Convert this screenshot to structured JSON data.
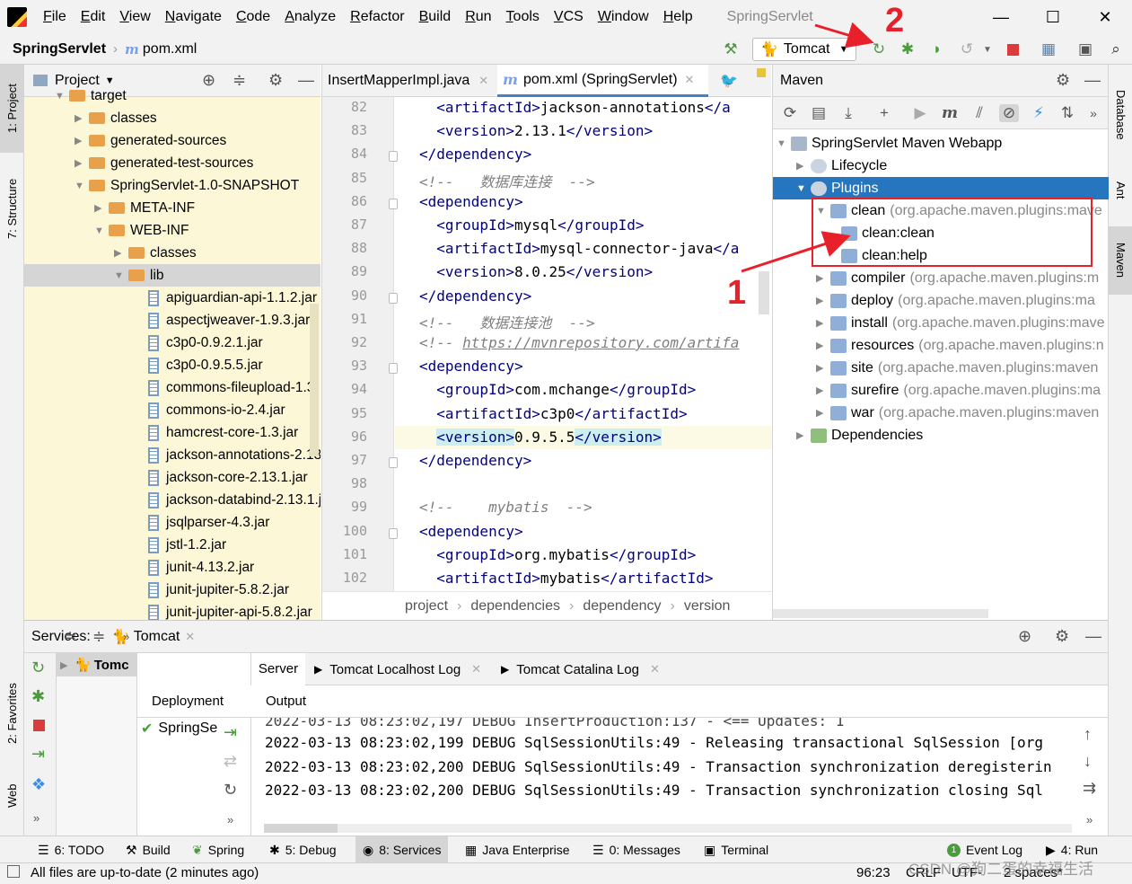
{
  "window": {
    "title": "SpringServlet",
    "menu": [
      "File",
      "Edit",
      "View",
      "Navigate",
      "Code",
      "Analyze",
      "Refactor",
      "Build",
      "Run",
      "Tools",
      "VCS",
      "Window",
      "Help"
    ]
  },
  "toolbar": {
    "project": "SpringServlet",
    "file": "pom.xml",
    "run_config": "Tomcat"
  },
  "left_strip": {
    "project_tab": "1: Project",
    "structure_tab": "7: Structure",
    "favorites_tab": "2: Favorites",
    "web_tab": "Web"
  },
  "right_strip": {
    "database_tab": "Database",
    "ant_tab": "Ant",
    "maven_tab": "Maven"
  },
  "project_panel": {
    "title": "Project",
    "items": [
      {
        "label": "target",
        "depth": 1,
        "kind": "folder",
        "arrow": "▼"
      },
      {
        "label": "classes",
        "depth": 2,
        "kind": "folder",
        "arrow": "▶"
      },
      {
        "label": "generated-sources",
        "depth": 2,
        "kind": "folder",
        "arrow": "▶"
      },
      {
        "label": "generated-test-sources",
        "depth": 2,
        "kind": "folder",
        "arrow": "▶"
      },
      {
        "label": "SpringServlet-1.0-SNAPSHOT",
        "depth": 2,
        "kind": "folder",
        "arrow": "▼"
      },
      {
        "label": "META-INF",
        "depth": 3,
        "kind": "folder",
        "arrow": "▶"
      },
      {
        "label": "WEB-INF",
        "depth": 3,
        "kind": "folder",
        "arrow": "▼"
      },
      {
        "label": "classes",
        "depth": 4,
        "kind": "folder",
        "arrow": "▶"
      },
      {
        "label": "lib",
        "depth": 4,
        "kind": "folder",
        "arrow": "▼"
      },
      {
        "label": "apiguardian-api-1.1.2.jar",
        "depth": 5,
        "kind": "jar"
      },
      {
        "label": "aspectjweaver-1.9.3.jar",
        "depth": 5,
        "kind": "jar"
      },
      {
        "label": "c3p0-0.9.2.1.jar",
        "depth": 5,
        "kind": "jar"
      },
      {
        "label": "c3p0-0.9.5.5.jar",
        "depth": 5,
        "kind": "jar"
      },
      {
        "label": "commons-fileupload-1.3.",
        "depth": 5,
        "kind": "jar"
      },
      {
        "label": "commons-io-2.4.jar",
        "depth": 5,
        "kind": "jar"
      },
      {
        "label": "hamcrest-core-1.3.jar",
        "depth": 5,
        "kind": "jar"
      },
      {
        "label": "jackson-annotations-2.13",
        "depth": 5,
        "kind": "jar"
      },
      {
        "label": "jackson-core-2.13.1.jar",
        "depth": 5,
        "kind": "jar"
      },
      {
        "label": "jackson-databind-2.13.1.j",
        "depth": 5,
        "kind": "jar"
      },
      {
        "label": "jsqlparser-4.3.jar",
        "depth": 5,
        "kind": "jar"
      },
      {
        "label": "jstl-1.2.jar",
        "depth": 5,
        "kind": "jar"
      },
      {
        "label": "junit-4.13.2.jar",
        "depth": 5,
        "kind": "jar"
      },
      {
        "label": "junit-jupiter-5.8.2.jar",
        "depth": 5,
        "kind": "jar"
      },
      {
        "label": "junit-jupiter-api-5.8.2.jar",
        "depth": 5,
        "kind": "jar"
      }
    ]
  },
  "editor": {
    "tabs": [
      {
        "label": "InsertMapperImpl.java"
      },
      {
        "label": "pom.xml (SpringServlet)"
      }
    ],
    "lines": [
      {
        "n": "82",
        "html": "  <span class=\"tg\">&lt;artifactId&gt;</span>jackson-annotations<span class=\"tg\">&lt;/a</span>"
      },
      {
        "n": "83",
        "html": "  <span class=\"tg\">&lt;version&gt;</span>2.13.1<span class=\"tg\">&lt;/version&gt;</span>"
      },
      {
        "n": "84",
        "html": "<span class=\"tg\">&lt;/dependency&gt;</span>"
      },
      {
        "n": "85",
        "html": "<span class=\"cm\">&lt;!--   数据库连接  --&gt;</span>"
      },
      {
        "n": "86",
        "html": "<span class=\"tg\">&lt;dependency&gt;</span>"
      },
      {
        "n": "87",
        "html": "  <span class=\"tg\">&lt;groupId&gt;</span>mysql<span class=\"tg\">&lt;/groupId&gt;</span>"
      },
      {
        "n": "88",
        "html": "  <span class=\"tg\">&lt;artifactId&gt;</span>mysql-connector-java<span class=\"tg\">&lt;/a</span>"
      },
      {
        "n": "89",
        "html": "  <span class=\"tg\">&lt;version&gt;</span>8.0.25<span class=\"tg\">&lt;/version&gt;</span>"
      },
      {
        "n": "90",
        "html": "<span class=\"tg\">&lt;/dependency&gt;</span>"
      },
      {
        "n": "91",
        "html": "<span class=\"cm\">&lt;!--   数据连接池  --&gt;</span>"
      },
      {
        "n": "92",
        "html": "<span class=\"cm\">&lt;!-- <u>https://mvnrepository.com/artifa</u></span>"
      },
      {
        "n": "93",
        "html": "<span class=\"tg\">&lt;dependency&gt;</span>"
      },
      {
        "n": "94",
        "html": "  <span class=\"tg\">&lt;groupId&gt;</span>com.mchange<span class=\"tg\">&lt;/groupId&gt;</span>"
      },
      {
        "n": "95",
        "html": "  <span class=\"tg\">&lt;artifactId&gt;</span>c3p0<span class=\"tg\">&lt;/artifactId&gt;</span>"
      },
      {
        "n": "96",
        "html": "  <span class=\"tg\" style=\"background:#cdeef0\">&lt;version&gt;</span>0.9.5.5<span class=\"tg\" style=\"background:#cdeef0\">&lt;/version&gt;</span>"
      },
      {
        "n": "97",
        "html": "<span class=\"tg\">&lt;/dependency&gt;</span>"
      },
      {
        "n": "98",
        "html": ""
      },
      {
        "n": "99",
        "html": "<span class=\"cm\">&lt;!--    mybatis  --&gt;</span>"
      },
      {
        "n": "100",
        "html": "<span class=\"tg\">&lt;dependency&gt;</span>"
      },
      {
        "n": "101",
        "html": "  <span class=\"tg\">&lt;groupId&gt;</span>org.mybatis<span class=\"tg\">&lt;/groupId&gt;</span>"
      },
      {
        "n": "102",
        "html": "  <span class=\"tg\">&lt;artifactId&gt;</span>mybatis<span class=\"tg\">&lt;/artifactId&gt;</span>"
      }
    ],
    "breadcrumb": [
      "project",
      "dependencies",
      "dependency",
      "version"
    ]
  },
  "maven": {
    "title": "Maven",
    "root": "SpringServlet Maven Webapp",
    "lifecycle": "Lifecycle",
    "plugins": "Plugins",
    "plugin_items": [
      {
        "name": "clean",
        "group": "(org.apache.maven.plugins:mave",
        "expanded": true
      },
      {
        "name": "compiler",
        "group": "(org.apache.maven.plugins:m"
      },
      {
        "name": "deploy",
        "group": "(org.apache.maven.plugins:ma"
      },
      {
        "name": "install",
        "group": "(org.apache.maven.plugins:mave"
      },
      {
        "name": "resources",
        "group": "(org.apache.maven.plugins:n"
      },
      {
        "name": "site",
        "group": "(org.apache.maven.plugins:maven"
      },
      {
        "name": "surefire",
        "group": "(org.apache.maven.plugins:ma"
      },
      {
        "name": "war",
        "group": "(org.apache.maven.plugins:maven"
      }
    ],
    "goals": [
      "clean:clean",
      "clean:help"
    ],
    "dependencies": "Dependencies"
  },
  "services": {
    "label": "Services:",
    "tab": "Tomcat",
    "tree_item": "Tomc",
    "deployment_col": "Deployment",
    "deployment_item": "SpringSe",
    "output_col": "Output",
    "tabs": [
      "Server",
      "Tomcat Localhost Log",
      "Tomcat Catalina Log"
    ],
    "log_lines": [
      "2022-03-13 08:23:02,199 DEBUG SqlSessionUtils:49 - Releasing transactional SqlSession [org",
      "2022-03-13 08:23:02,200 DEBUG SqlSessionUtils:49 - Transaction synchronization deregisterin",
      "2022-03-13 08:23:02,200 DEBUG SqlSessionUtils:49 - Transaction synchronization closing Sql"
    ]
  },
  "bottom_tools": [
    "6: TODO",
    "Build",
    "Spring",
    "5: Debug",
    "8: Services",
    "Java Enterprise",
    "0: Messages",
    "Terminal",
    "Event Log",
    "4: Run"
  ],
  "status": {
    "message": "All files are up-to-date (2 minutes ago)",
    "position": "96:23",
    "line_sep": "CRLF",
    "encoding": "UTF-",
    "indent": "2 spaces*",
    "watermark": "CSDN @狗二蛋的幸福生活"
  },
  "annotations": {
    "one": "1",
    "two": "2",
    "accent": "#e8202a"
  }
}
